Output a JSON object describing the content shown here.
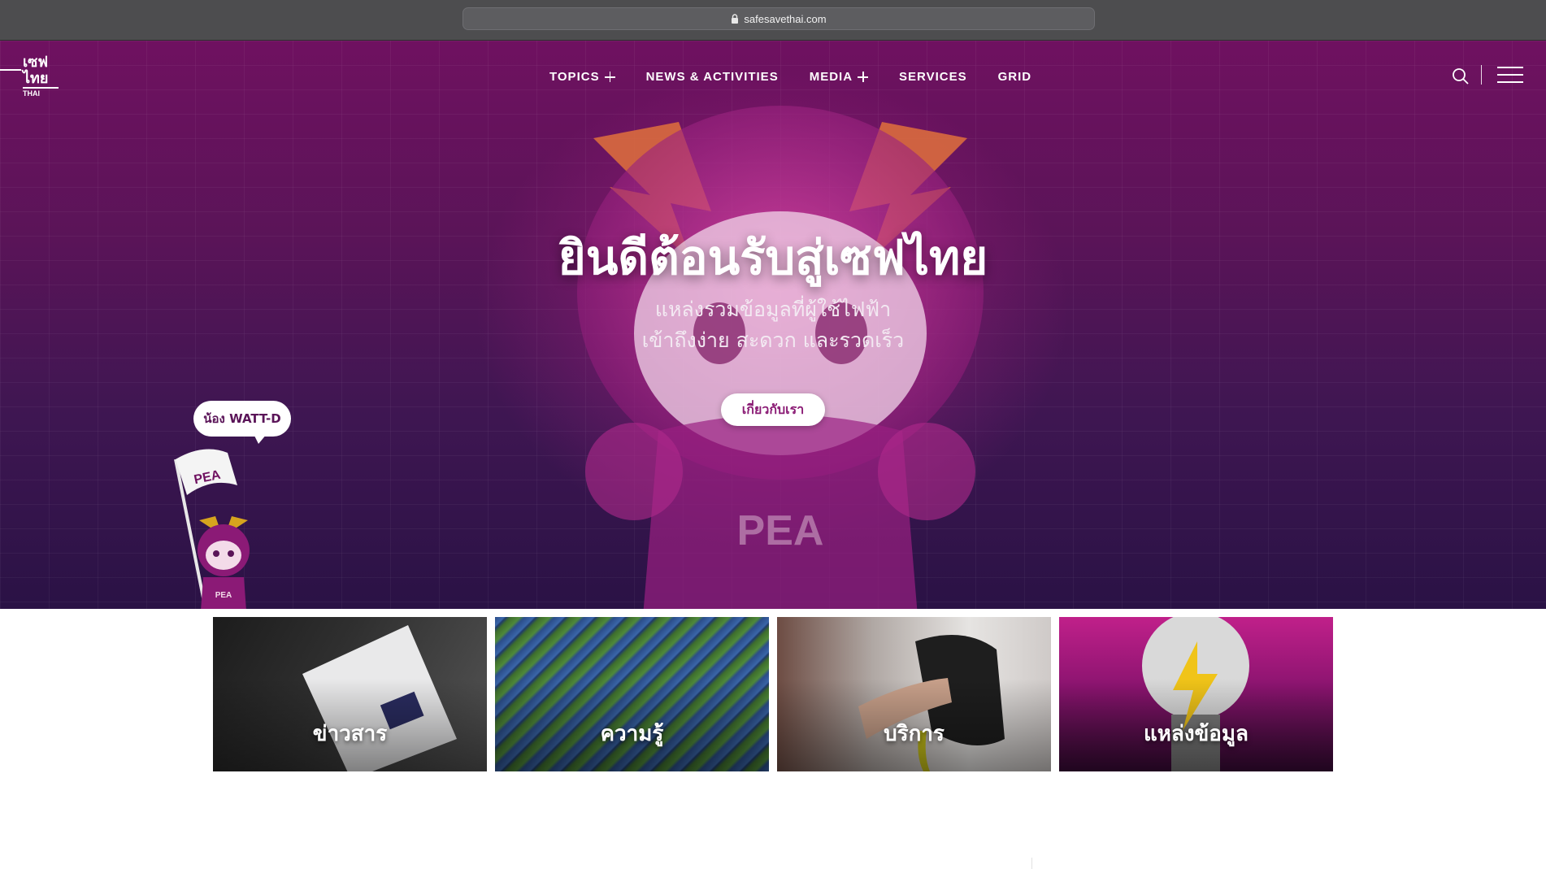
{
  "browser": {
    "url": "safesavethai.com"
  },
  "header": {
    "logo_text": "เซฟไทย SAFE SAVE THAI",
    "nav": [
      {
        "label": "TOPICS",
        "expandable": true
      },
      {
        "label": "NEWS & ACTIVITIES",
        "expandable": false
      },
      {
        "label": "MEDIA",
        "expandable": true
      },
      {
        "label": "SERVICES",
        "expandable": false
      },
      {
        "label": "GRID",
        "expandable": false
      }
    ],
    "icons": [
      "search-icon",
      "hamburger-menu-icon"
    ]
  },
  "hero": {
    "title": "ยินดีต้อนรับสู่เซฟไทย",
    "subtitle_line1": "แหล่งรวมข้อมูลที่ผู้ใช้ไฟฟ้า",
    "subtitle_line2": "เข้าถึงง่าย สะดวก และรวดเร็ว",
    "button_label": "เกี่ยวกับเรา",
    "mascot_text": "PEA",
    "bubble_text": "น้อง WATT-D"
  },
  "cards": [
    {
      "label": "ข่าวสาร"
    },
    {
      "label": "ความรู้"
    },
    {
      "label": "บริการ"
    },
    {
      "label": "แหล่งข้อมูล"
    }
  ],
  "colors": {
    "brand_purple": "#6f1160",
    "brand_magenta": "#c0208a",
    "button_text": "#8a1a74"
  }
}
